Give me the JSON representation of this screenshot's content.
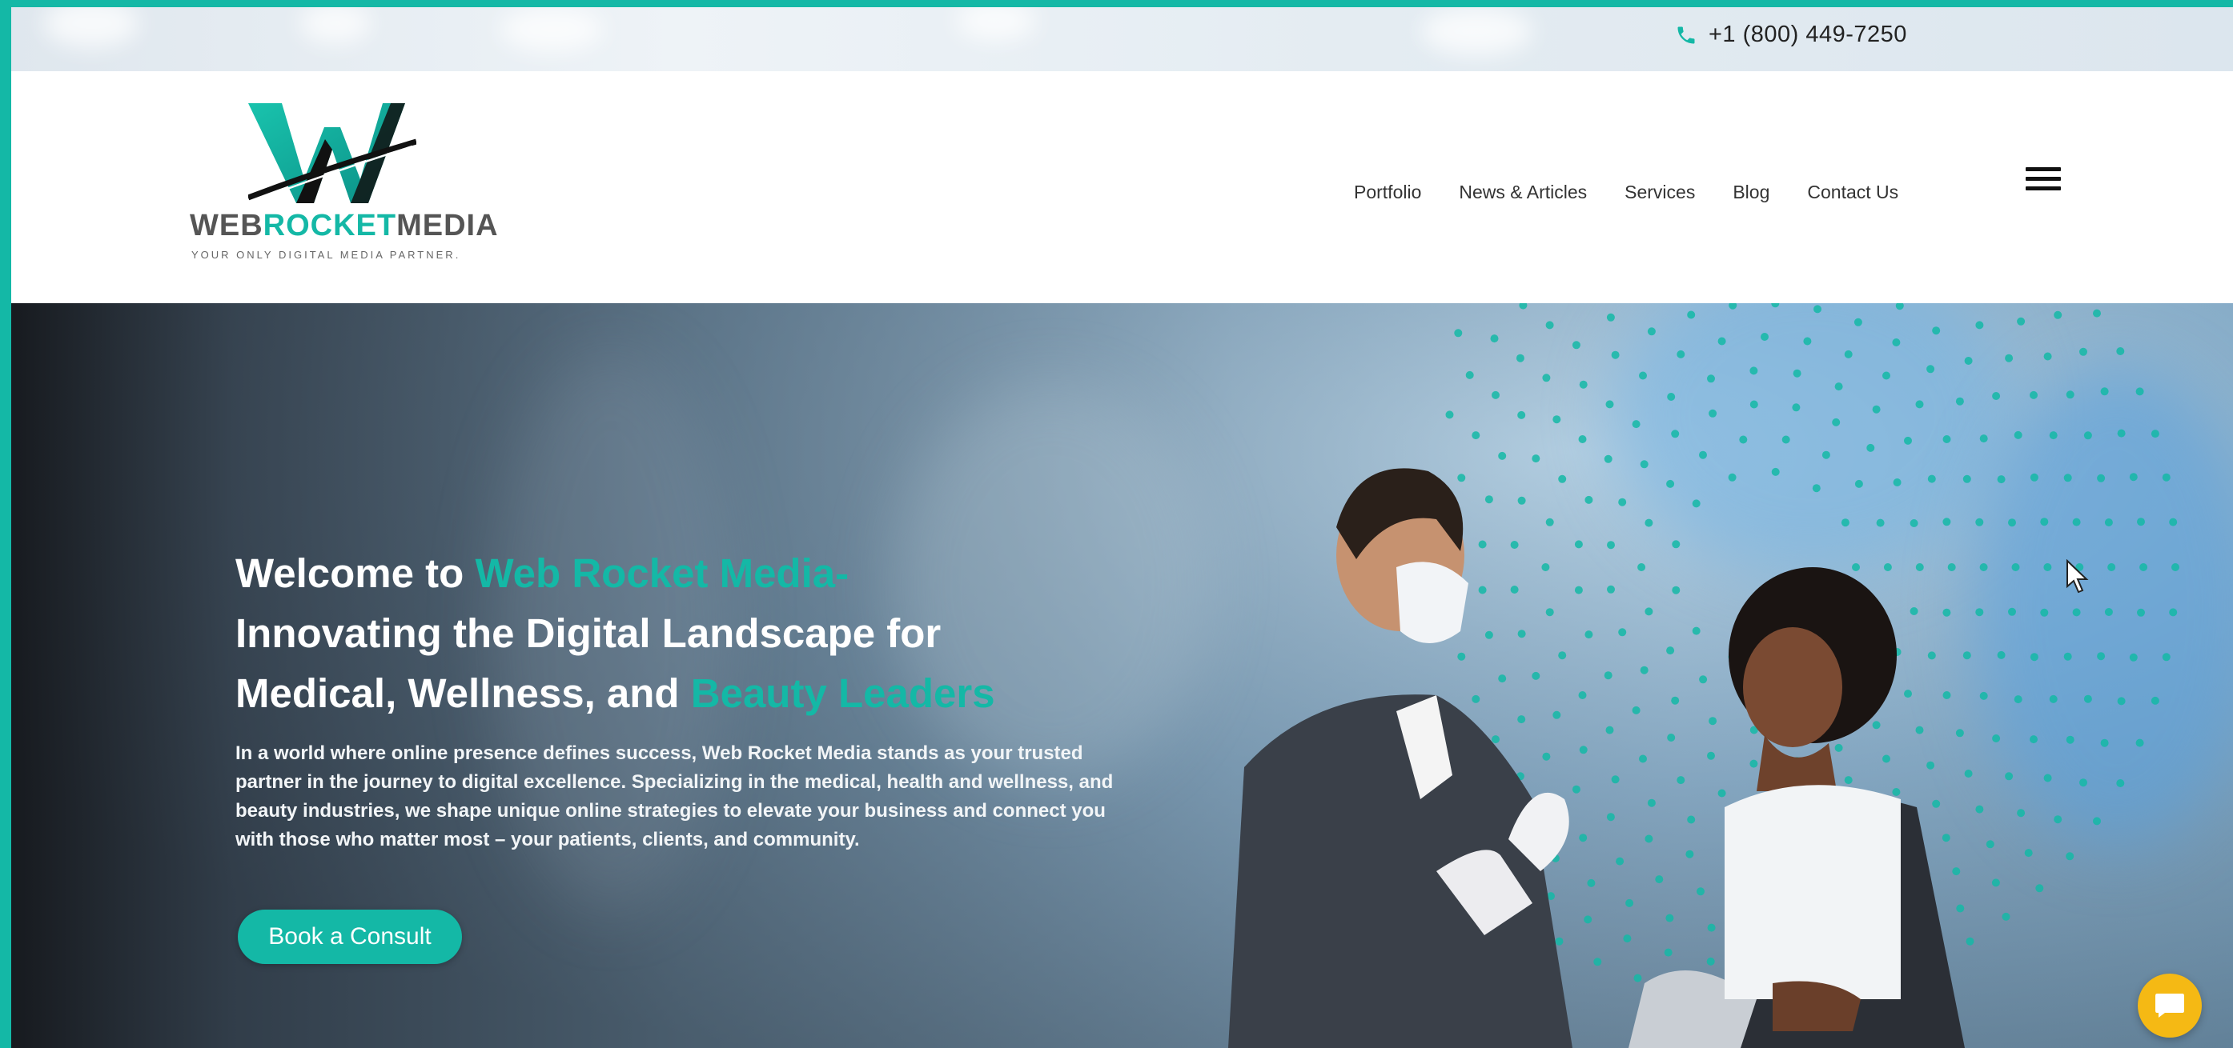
{
  "topbar": {
    "phone_number": "+1 (800) 449-7250",
    "phone_icon": "phone-icon"
  },
  "logo": {
    "word_part1": "WEB",
    "word_part2": "ROCKET",
    "word_part3": "MEDIA",
    "tagline": "YOUR ONLY DIGITAL MEDIA PARTNER."
  },
  "nav": {
    "items": [
      {
        "label": "Portfolio"
      },
      {
        "label": "News & Articles"
      },
      {
        "label": "Services"
      },
      {
        "label": "Blog"
      },
      {
        "label": "Contact Us"
      }
    ],
    "menu_icon": "hamburger-menu-icon"
  },
  "hero": {
    "title_part1": "Welcome to ",
    "title_accent1": "Web Rocket Media-",
    "title_part2": "Innovating the Digital Landscape for",
    "title_part3": "Medical, Wellness, and ",
    "title_accent2": "Beauty Leaders",
    "description": "In a world where online presence defines success, Web Rocket Media stands as your trusted partner in the journey to digital excellence. Specializing in the medical, health and wellness, and beauty industries, we shape unique online strategies to elevate your business and connect you with those who matter most – your patients, clients, and community.",
    "cta_label": "Book a Consult"
  },
  "chat_icon": "chat-bubble-icon",
  "colors": {
    "accent": "#14b8a6",
    "chat": "#f5b914"
  }
}
